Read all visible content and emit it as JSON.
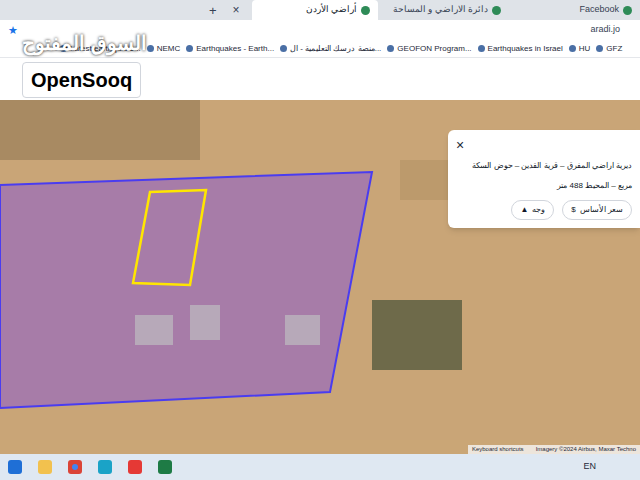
{
  "browser": {
    "tabs": [
      {
        "label": "أراضي الأردن",
        "selected": true
      },
      {
        "label": "دائرة الاراضي و المساحة",
        "selected": false
      },
      {
        "label": "Facebook",
        "selected": false
      }
    ],
    "new_tab": "+",
    "close_tab": "×",
    "address": "aradi.jo",
    "bookmark_star": "★",
    "bookmarks": [
      "Latest earthquake...",
      "NEMC",
      "Earthquakes - Earth...",
      "منصة درسك التعليمية - ال...",
      "GEOFON Program...",
      "Earthquakes in Israel",
      "HU",
      "GFZ"
    ]
  },
  "watermark": {
    "arabic": "السوق المفتوح",
    "latin": "OpenSooq"
  },
  "popup": {
    "close": "×",
    "line1": "ديرية اراضي المفرق – قرية القدين – حوض السكة",
    "line2": "مربع – المحيط 488 متر",
    "buttons": [
      {
        "label": "سعر الأساس",
        "icon": "$"
      },
      {
        "label": "وجه",
        "icon": "▲"
      }
    ]
  },
  "map": {
    "shortcuts": "Keyboard shortcuts",
    "attribution": "Imagery ©2024 Airbus, Maxar Techno"
  },
  "taskbar": {
    "language": "EN"
  }
}
